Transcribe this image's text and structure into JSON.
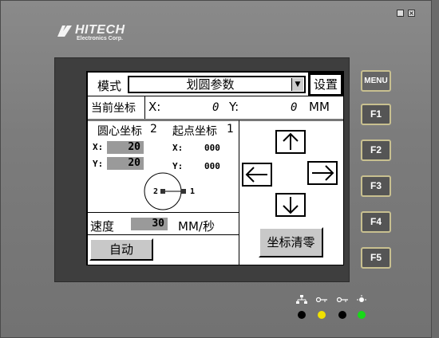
{
  "brand": {
    "name": "HITECH",
    "subtitle": "Electronics Corp."
  },
  "header": {
    "mode_label": "模式",
    "mode_value": "划圆参数",
    "settings_label": "设置"
  },
  "current_coords": {
    "label": "当前坐标",
    "x_label": "X:",
    "x_value": "0",
    "y_label": "Y:",
    "y_value": "0",
    "unit": "MM"
  },
  "center": {
    "label": "圆心坐标",
    "marker": "2",
    "x_label": "X:",
    "x_value": "20",
    "y_label": "Y:",
    "y_value": "20"
  },
  "start": {
    "label": "起点坐标",
    "marker": "1",
    "x_label": "X:",
    "x_value": "000",
    "y_label": "Y:",
    "y_value": "000"
  },
  "diagram": {
    "point2_label": "2",
    "point1_label": "1"
  },
  "speed": {
    "label": "速度",
    "value": "30",
    "unit": "MM/秒"
  },
  "buttons": {
    "auto": "自动",
    "reset_coords": "坐标清零"
  },
  "side_keys": [
    "MENU",
    "F1",
    "F2",
    "F3",
    "F4",
    "F5"
  ],
  "indicators": [
    {
      "icon": "network-icon",
      "color": "#000000"
    },
    {
      "icon": "key-icon",
      "color": "#f0e000"
    },
    {
      "icon": "key-icon",
      "color": "#000000"
    },
    {
      "icon": "light-icon",
      "color": "#18d818"
    }
  ]
}
